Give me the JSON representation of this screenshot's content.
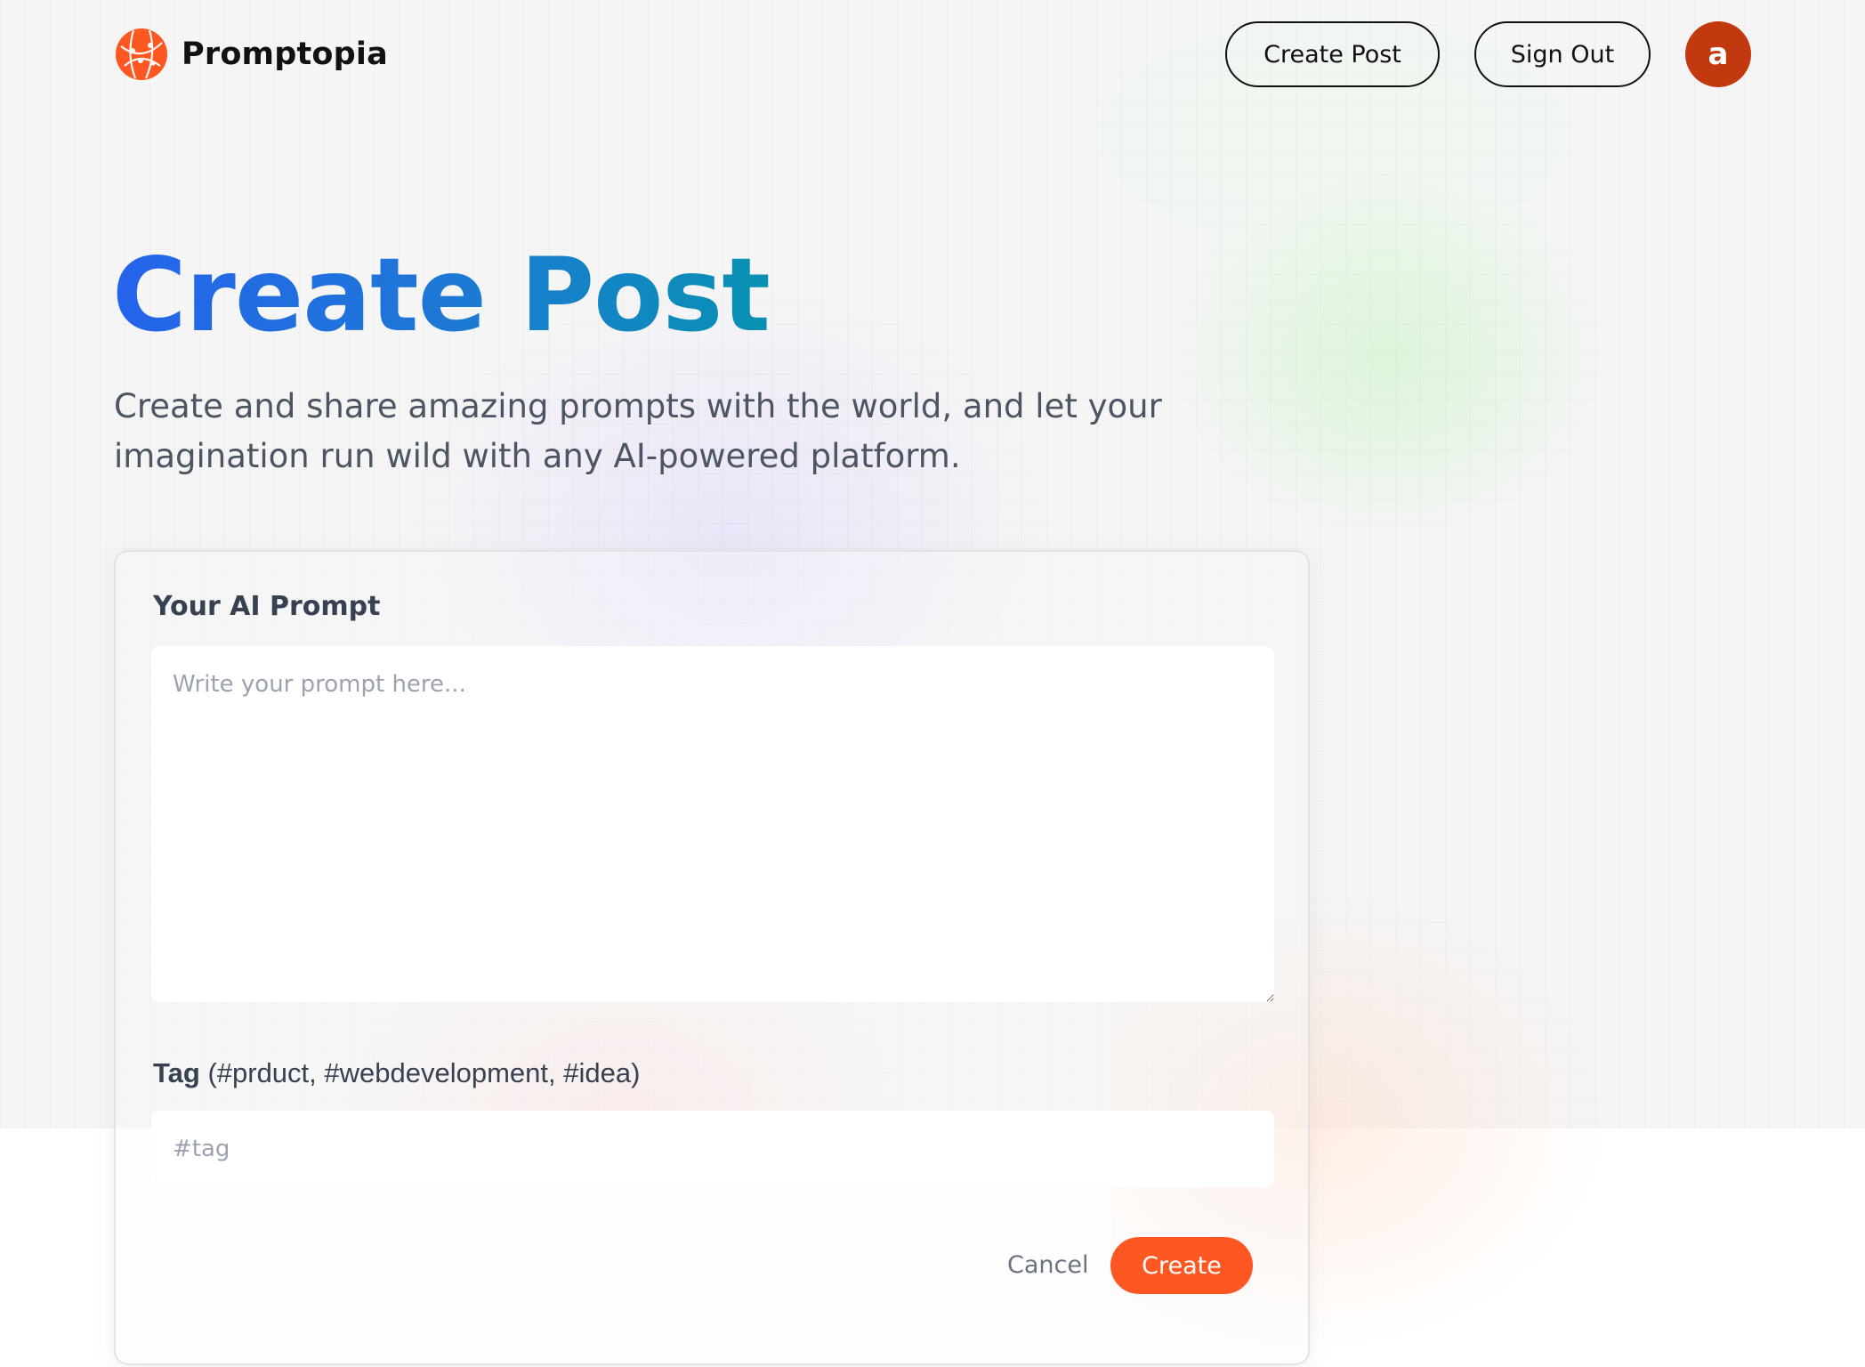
{
  "nav": {
    "brand": "Promptopia",
    "create_post": "Create Post",
    "sign_out": "Sign Out",
    "avatar_initial": "a"
  },
  "hero": {
    "title": "Create Post",
    "description": "Create and share amazing prompts with the world, and let your imagination run wild with any AI-powered platform."
  },
  "form": {
    "prompt_label": "Your AI Prompt",
    "prompt_placeholder": "Write your prompt here...",
    "prompt_value": "",
    "tag_label_bold": "Tag",
    "tag_label_hint": "(#prduct, #webdevelopment, #idea)",
    "tag_placeholder": "#tag",
    "tag_value": "",
    "cancel": "Cancel",
    "submit": "Create"
  },
  "colors": {
    "accent": "#ff5722",
    "avatar": "#c2390f",
    "title_gradient_start": "#2563eb",
    "title_gradient_end": "#0891b2"
  }
}
